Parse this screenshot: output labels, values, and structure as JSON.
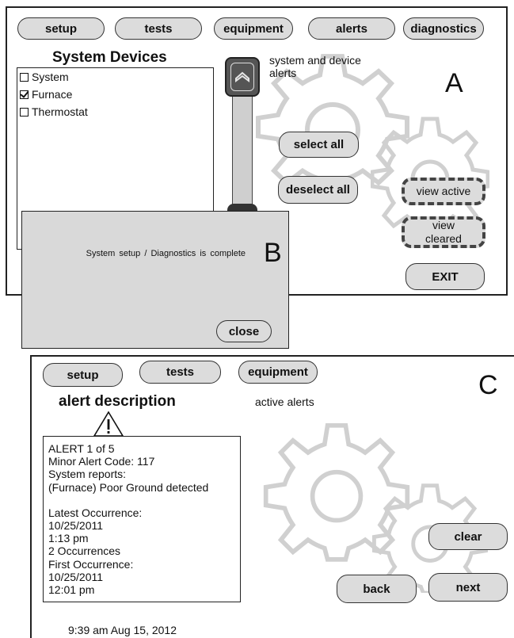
{
  "panel_a": {
    "label": "A",
    "tabs": [
      "setup",
      "tests",
      "equipment",
      "alerts",
      "diagnostics"
    ],
    "devices_title": "System Devices",
    "devices": [
      {
        "name": "System",
        "checked": false
      },
      {
        "name": "Furnace",
        "checked": true
      },
      {
        "name": "Thermostat",
        "checked": false
      }
    ],
    "alerts_caption_line1": "system and device",
    "alerts_caption_line2": "alerts",
    "select_all": "select all",
    "deselect_all": "deselect all",
    "view_active": "view active",
    "view_cleared_line1": "view",
    "view_cleared_line2": "cleared",
    "exit": "EXIT"
  },
  "panel_b": {
    "label": "B",
    "message": "System setup / Diagnostics is complete",
    "close": "close"
  },
  "panel_c": {
    "label": "C",
    "tabs": [
      "setup",
      "tests",
      "equipment"
    ],
    "title": "alert description",
    "caption": "active alerts",
    "alert_lines": [
      "ALERT 1 of 5",
      "Minor Alert Code: 117",
      "System reports:",
      "(Furnace) Poor Ground detected",
      "",
      "Latest Occurrence:",
      "10/25/2011",
      "1:13 pm",
      "2 Occurrences",
      "First Occurrence:",
      "10/25/2011",
      "12:01 pm"
    ],
    "clear": "clear",
    "back": "back",
    "next": "next",
    "timestamp": "9:39 am Aug 15, 2012"
  },
  "icons": [
    "gear-icon",
    "chevron-up-icon",
    "warning-icon",
    "checkbox-icon"
  ],
  "colors": {
    "button_fill": "#dcdcdc",
    "dialog_fill": "#d9d9d9",
    "gear_stroke": "#d0d0d0",
    "outline": "#222222"
  }
}
